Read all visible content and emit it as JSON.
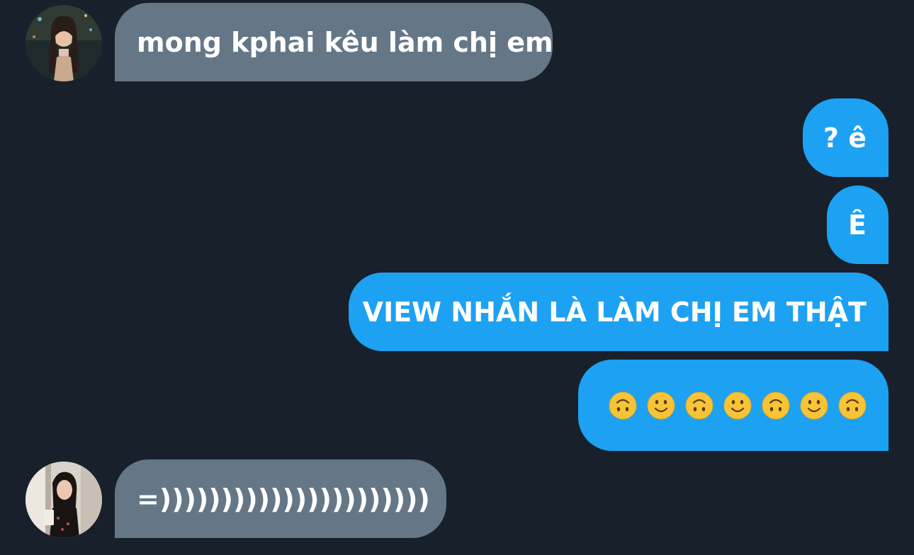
{
  "messages": [
    {
      "sender": "other",
      "avatar": "avatar-1",
      "text": "mong kphai kêu làm chị em"
    },
    {
      "sender": "me",
      "text": "? ê"
    },
    {
      "sender": "me",
      "text": "Ê"
    },
    {
      "sender": "me",
      "text": "VIEW NHẮN LÀ LÀM CHỊ EM THẬT"
    },
    {
      "sender": "me",
      "emojis": [
        "upside-down-face-icon",
        "slightly-smiling-face-icon",
        "upside-down-face-icon",
        "slightly-smiling-face-icon",
        "upside-down-face-icon",
        "slightly-smiling-face-icon",
        "upside-down-face-icon"
      ]
    },
    {
      "sender": "other",
      "avatar": "avatar-2",
      "text": "=))))))))))))))))))))))"
    }
  ],
  "colors": {
    "background": "#17202b",
    "incoming_bubble": "#657786",
    "outgoing_bubble": "#1da1f2",
    "text": "#ffffff",
    "emoji_face": "#f7c437"
  }
}
